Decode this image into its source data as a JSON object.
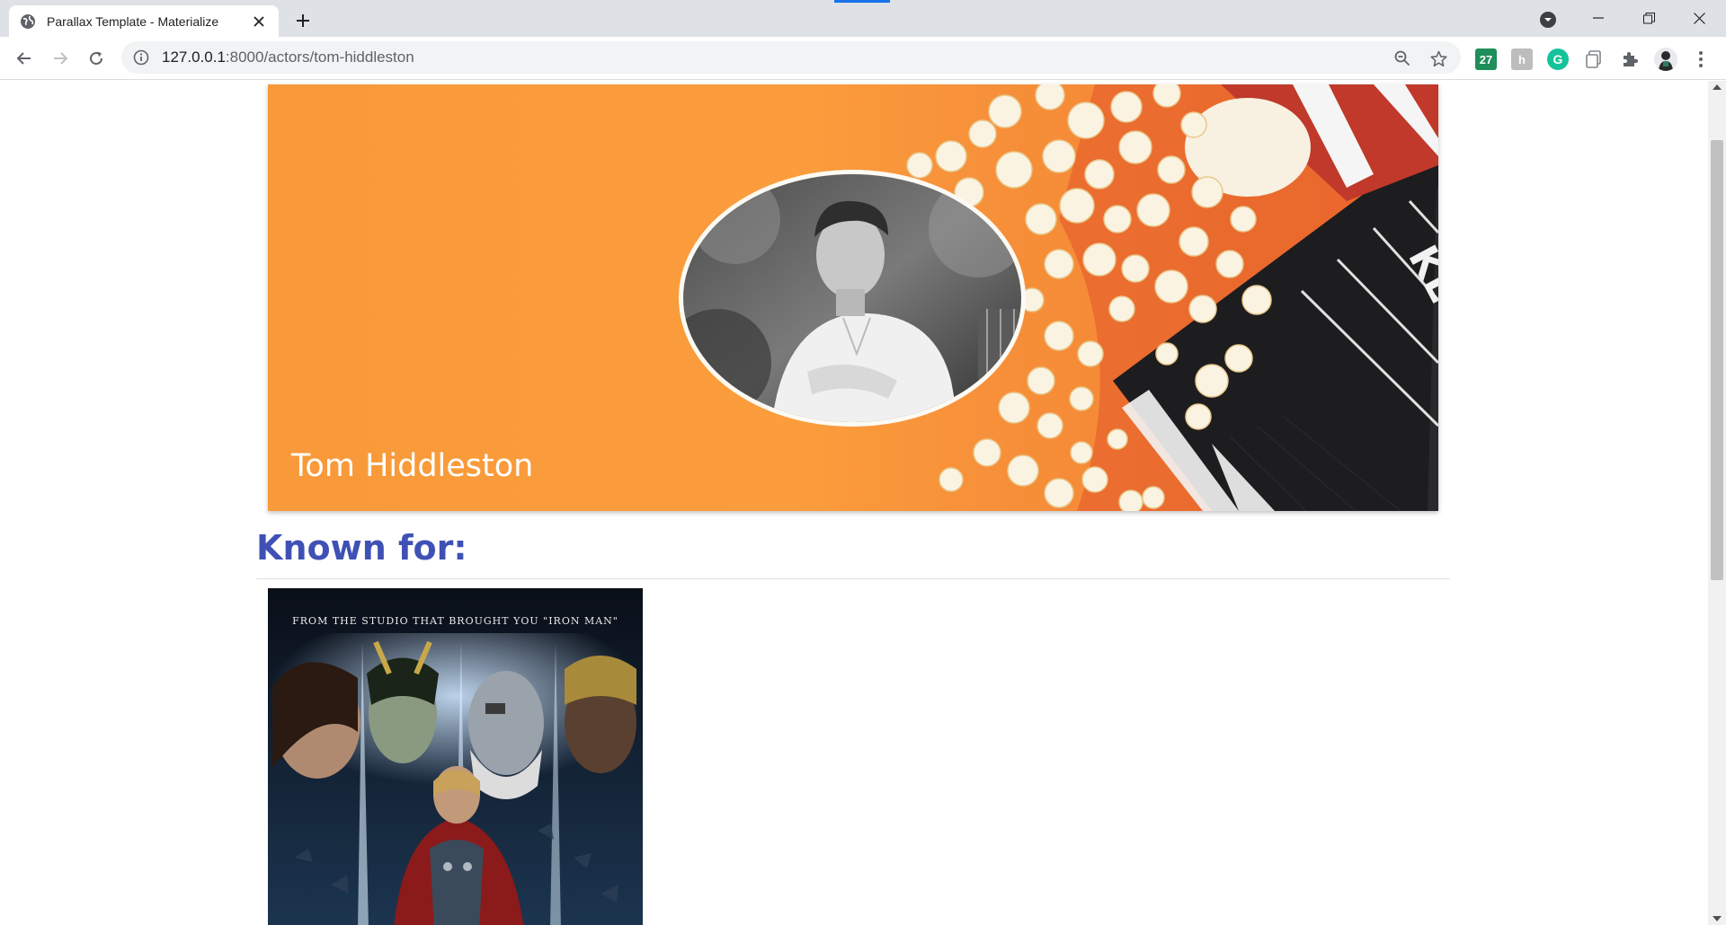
{
  "browser": {
    "tab_title": "Parallax Template - Materialize",
    "url_host": "127.0.0.1",
    "url_path": ":8000/actors/tom-hiddleston",
    "extension_badge": "27",
    "extension_h": "h",
    "extension_g": "G",
    "icons": [
      "globe-icon",
      "close-icon",
      "plus-icon",
      "back-icon",
      "forward-icon",
      "reload-icon",
      "info-icon",
      "zoom-icon",
      "star-icon",
      "puzzle-icon",
      "menu-icon"
    ]
  },
  "hero": {
    "actor_name": "Tom Hiddleston",
    "background_color": "#f89a3a"
  },
  "known_for": {
    "heading": "Known for:",
    "posters": [
      {
        "tagline": "FROM THE STUDIO THAT BROUGHT YOU \"IRON MAN\""
      }
    ]
  },
  "colors": {
    "heading": "#3f51b5",
    "tab_indicator": "#1a73e8"
  }
}
